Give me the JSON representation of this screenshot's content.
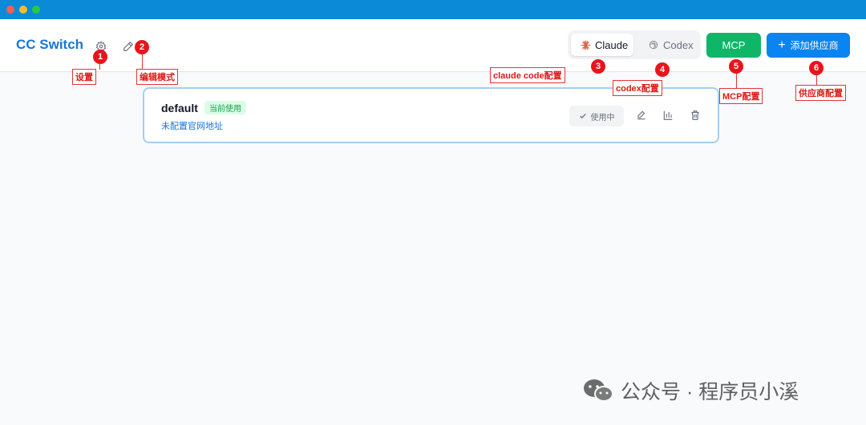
{
  "window": {
    "title": "CC Switch"
  },
  "header": {
    "apps": [
      {
        "label": "Claude",
        "active": true
      },
      {
        "label": "Codex",
        "active": false
      }
    ],
    "mcp_label": "MCP",
    "add_provider_label": "添加供应商"
  },
  "providers": [
    {
      "name": "default",
      "badge": "当前使用",
      "url_text": "未配置官网地址",
      "status": "使用中"
    }
  ],
  "annotations": [
    {
      "number": "1",
      "label": "设置"
    },
    {
      "number": "2",
      "label": "编辑模式"
    },
    {
      "number": "3",
      "label": "claude code配置"
    },
    {
      "number": "4",
      "label": "codex配置"
    },
    {
      "number": "5",
      "label": "MCP配置"
    },
    {
      "number": "6",
      "label": "供应商配置"
    }
  ],
  "watermark": "公众号 · 程序员小溪",
  "colors": {
    "titlebar": "#0b8ad8",
    "brand": "#1677d9",
    "mcp_green": "#10b668",
    "add_blue": "#0a84f0",
    "annotation_red": "#e8141c"
  }
}
